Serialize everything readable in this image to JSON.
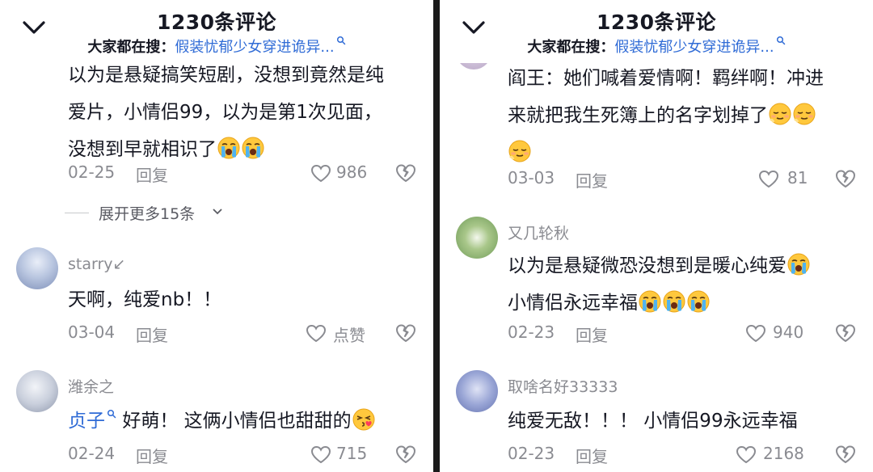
{
  "left": {
    "header": {
      "title": "1230条评论",
      "search_prefix": "大家都在搜：",
      "search_term": "假装忧郁少女穿进诡异..."
    },
    "top_comment": {
      "lines": [
        "以为是悬疑搞笑短剧，没想到竟然是纯",
        "爱片，小情侣99，以为是第1次见面，",
        "没想到早就相识了"
      ],
      "emojis": [
        "crying-emoji",
        "crying-emoji"
      ],
      "date": "02-25",
      "reply": "回复",
      "likes": "986"
    },
    "expand": {
      "label": "展开更多15条"
    },
    "comments": [
      {
        "username": "starry↙",
        "text": "天啊，纯爱nb！！",
        "date": "03-04",
        "reply": "回复",
        "likes": "点赞"
      },
      {
        "username": "潍余之",
        "mention": "贞子",
        "text": "好萌！ 这俩小情侣也甜甜的",
        "emoji": "kissing-emoji",
        "date": "02-24",
        "reply": "回复",
        "likes": "715"
      }
    ]
  },
  "right": {
    "header": {
      "title": "1230条评论",
      "search_prefix": "大家都在搜：",
      "search_term": "假装忧郁少女穿进诡异..."
    },
    "top_comment": {
      "lines": [
        "阎王：她们喊着爱情啊！羁绊啊！冲进",
        "来就把我生死簿上的名字划掉了"
      ],
      "emojis": [
        "sleepy-emoji",
        "sleepy-emoji",
        "sleepy-emoji"
      ],
      "date": "03-03",
      "reply": "回复",
      "likes": "81"
    },
    "comments": [
      {
        "username": "又几轮秋",
        "lines": [
          "以为是悬疑微恐没想到是暖心纯爱",
          "小情侣永远幸福"
        ],
        "emoji": "crying-emoji",
        "date": "02-23",
        "reply": "回复",
        "likes": "940"
      },
      {
        "username": "取啥名好33333",
        "text": "纯爱无敌！！！ 小情侣99永远幸福",
        "date": "02-23",
        "reply": "回复",
        "likes": "2168"
      }
    ]
  },
  "colors": {
    "text": "#161823",
    "muted": "#8a8b91",
    "link": "#2f6bd6",
    "background": "#ffffff"
  }
}
